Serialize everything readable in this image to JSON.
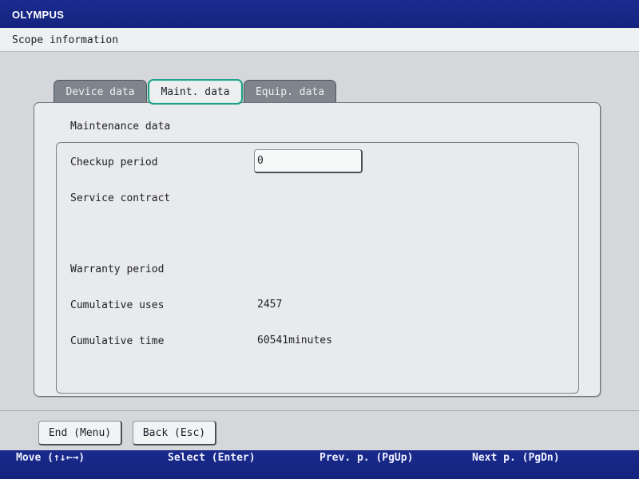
{
  "brand": {
    "logo_text": "OLYMPUS"
  },
  "header": {
    "title": "Scope information"
  },
  "tabs": [
    {
      "label": "Device data",
      "active": false
    },
    {
      "label": "Maint. data",
      "active": true
    },
    {
      "label": "Equip. data",
      "active": false
    }
  ],
  "panel": {
    "section_title": "Maintenance data",
    "fields": {
      "checkup_period": {
        "label": "Checkup period",
        "value": "0"
      },
      "service_contract": {
        "label": "Service contract",
        "value": ""
      },
      "warranty_period": {
        "label": "Warranty period",
        "value": ""
      },
      "cumulative_uses": {
        "label": "Cumulative uses",
        "value": "2457"
      },
      "cumulative_time": {
        "label": "Cumulative time",
        "value": "60541minutes"
      }
    }
  },
  "buttons": {
    "end_label": "End (Menu)",
    "back_label": "Back (Esc)"
  },
  "hints": {
    "move": "Move (↑↓←→)",
    "select": "Select (Enter)",
    "prev_page": "Prev. p. (PgUp)",
    "next_page": "Next p. (PgDn)"
  },
  "colors": {
    "brand_bar": "#1b2b8e",
    "active_tab_border": "#1fa088",
    "inactive_tab": "#7f858d",
    "panel_background": "#eaebec",
    "work_area": "#d5d7da"
  }
}
